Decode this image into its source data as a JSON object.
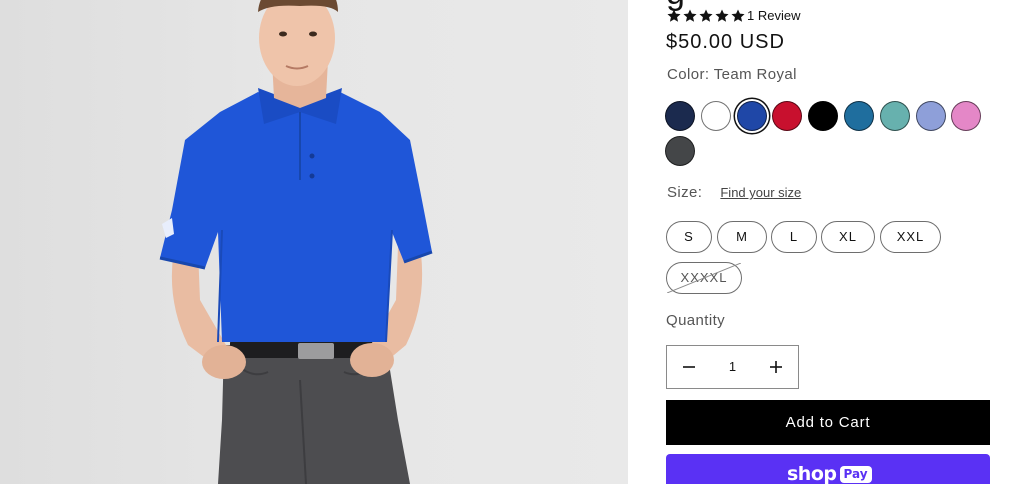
{
  "product": {
    "title_fragment": "g",
    "review_label": "1 Review",
    "price": "$50.00 USD",
    "color_label": "Color: Team Royal",
    "size_label": "Size:",
    "size_guide_link": "Find your size",
    "quantity_label": "Quantity",
    "quantity_value": "1",
    "add_to_cart_label": "Add to Cart",
    "shop_pay": {
      "shop": "shop",
      "pay": "Pay"
    }
  },
  "rating": {
    "stars_filled": 5,
    "stars_total": 5
  },
  "colors": {
    "options": [
      {
        "name": "navy",
        "hex": "#1b2a4e"
      },
      {
        "name": "white",
        "hex": "#ffffff"
      },
      {
        "name": "team-royal",
        "hex": "#1f47a7",
        "selected": true
      },
      {
        "name": "red",
        "hex": "#c8102e"
      },
      {
        "name": "black",
        "hex": "#000000"
      },
      {
        "name": "teal-blue",
        "hex": "#1f6e9e"
      },
      {
        "name": "aqua",
        "hex": "#67b1ae"
      },
      {
        "name": "periwinkle",
        "hex": "#8e9fd9"
      },
      {
        "name": "pink",
        "hex": "#e487c7"
      },
      {
        "name": "charcoal",
        "hex": "#444648"
      }
    ]
  },
  "sizes": [
    {
      "label": "S",
      "available": true
    },
    {
      "label": "M",
      "available": true
    },
    {
      "label": "L",
      "available": true
    },
    {
      "label": "XL",
      "available": true
    },
    {
      "label": "XXL",
      "available": true
    },
    {
      "label": "XXXXL",
      "available": false
    }
  ],
  "theme": {
    "shop_pay_purple": "#5a31f4",
    "button_black": "#000000",
    "shirt_color": "#1f56d8"
  }
}
